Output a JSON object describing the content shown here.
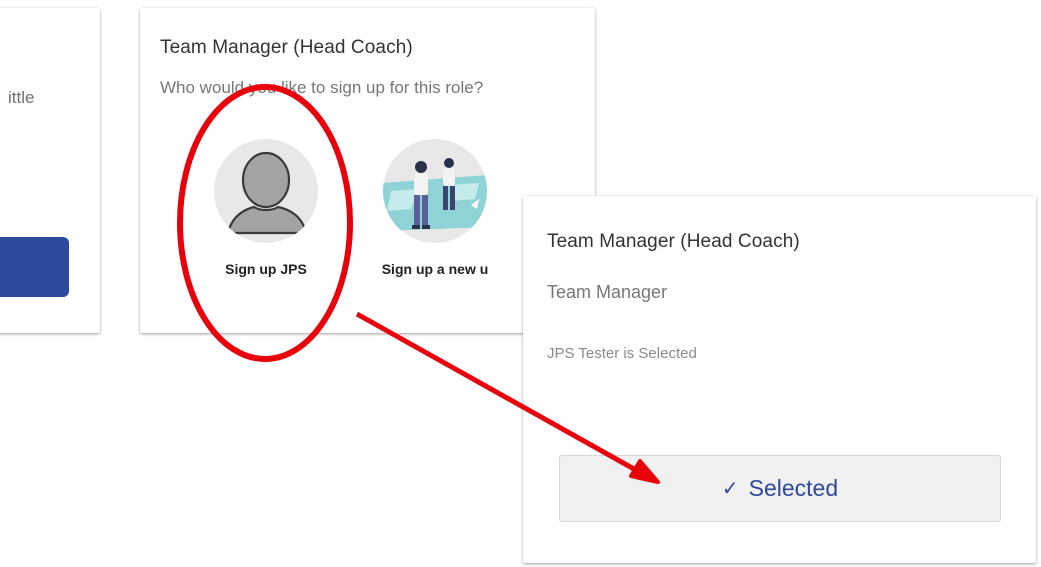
{
  "left_card": {
    "text": "ittle"
  },
  "main_card": {
    "title": "Team Manager (Head Coach)",
    "subtitle": "Who would you like to sign up for this role?",
    "options": [
      {
        "label": "Sign up JPS",
        "icon": "user-avatar-icon"
      },
      {
        "label": "Sign up a new u",
        "icon": "people-illustration-icon"
      }
    ]
  },
  "selected_card": {
    "title": "Team Manager (Head Coach)",
    "role": "Team Manager",
    "status": "JPS Tester is Selected",
    "button_label": "Selected",
    "button_icon": "checkmark-icon"
  },
  "colors": {
    "accent": "#2e4a9c",
    "annotation": "#e8000b",
    "avatar_bg": "#e8e8e8",
    "avatar_fill": "#a3a3a3"
  }
}
